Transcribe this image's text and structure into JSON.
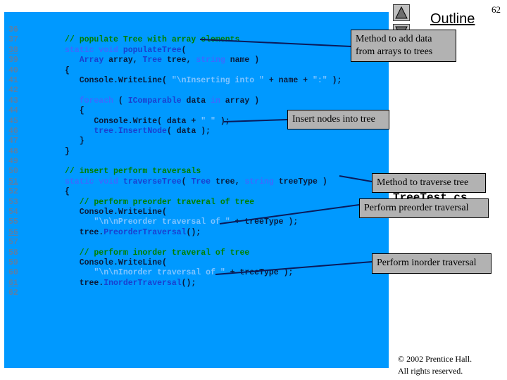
{
  "slide": {
    "page_number": "62",
    "outline_label": "Outline",
    "filename": "TreeTest.cs",
    "copyright_line1": "© 2002 Prentice Hall.",
    "copyright_line2": "All rights reserved.",
    "colors": {
      "code_background": "#0099ff",
      "callout_background": "#b2b2b2",
      "comment": "#008000",
      "keyword": "#3b6bff",
      "line_number": "#5b7fa6"
    }
  },
  "navigation": {
    "up_icon": "triangle-up-icon",
    "down_icon": "triangle-down-icon"
  },
  "code": {
    "lines": [
      {
        "num": "36",
        "underline": false,
        "tokens": []
      },
      {
        "num": "37",
        "underline": false,
        "tokens": [
          {
            "c": "t-comment",
            "t": "// populate Tree with array elements"
          }
        ]
      },
      {
        "num": "38",
        "underline": true,
        "tokens": [
          {
            "c": "t-kw",
            "t": "static void "
          },
          {
            "c": "t-type",
            "t": "populateTree"
          },
          {
            "c": "t-plain",
            "t": "("
          }
        ]
      },
      {
        "num": "39",
        "underline": false,
        "tokens": [
          {
            "c": "t-plain",
            "t": "   "
          },
          {
            "c": "t-type",
            "t": "Array"
          },
          {
            "c": "t-plain",
            "t": " array, "
          },
          {
            "c": "t-type",
            "t": "Tree"
          },
          {
            "c": "t-plain",
            "t": " tree, "
          },
          {
            "c": "t-kw",
            "t": "string"
          },
          {
            "c": "t-plain",
            "t": " name )"
          }
        ]
      },
      {
        "num": "40",
        "underline": false,
        "tokens": [
          {
            "c": "t-plain",
            "t": "{"
          }
        ]
      },
      {
        "num": "41",
        "underline": false,
        "tokens": [
          {
            "c": "t-plain",
            "t": "   Console.WriteLine( "
          },
          {
            "c": "t-str",
            "t": "\"\\nInserting into \""
          },
          {
            "c": "t-plain",
            "t": " + name + "
          },
          {
            "c": "t-str",
            "t": "\":\""
          },
          {
            "c": "t-plain",
            "t": " );"
          }
        ]
      },
      {
        "num": "42",
        "underline": false,
        "tokens": []
      },
      {
        "num": "43",
        "underline": false,
        "tokens": [
          {
            "c": "t-kw",
            "t": "   foreach"
          },
          {
            "c": "t-plain",
            "t": " ( "
          },
          {
            "c": "t-type",
            "t": "IComparable"
          },
          {
            "c": "t-plain",
            "t": " data "
          },
          {
            "c": "t-kw",
            "t": "in"
          },
          {
            "c": "t-plain",
            "t": " array )"
          }
        ]
      },
      {
        "num": "44",
        "underline": false,
        "tokens": [
          {
            "c": "t-plain",
            "t": "   {"
          }
        ]
      },
      {
        "num": "45",
        "underline": false,
        "tokens": [
          {
            "c": "t-plain",
            "t": "      Console.Write( data + "
          },
          {
            "c": "t-str",
            "t": "\" \""
          },
          {
            "c": "t-plain",
            "t": " );"
          }
        ]
      },
      {
        "num": "46",
        "underline": true,
        "tokens": [
          {
            "c": "t-member",
            "t": "      tree.InsertNode"
          },
          {
            "c": "t-plain",
            "t": "( data );"
          }
        ]
      },
      {
        "num": "47",
        "underline": false,
        "tokens": [
          {
            "c": "t-plain",
            "t": "   }"
          }
        ]
      },
      {
        "num": "48",
        "underline": false,
        "tokens": [
          {
            "c": "t-plain",
            "t": "}"
          }
        ]
      },
      {
        "num": "49",
        "underline": false,
        "tokens": []
      },
      {
        "num": "50",
        "underline": false,
        "tokens": [
          {
            "c": "t-comment",
            "t": "// insert perform traversals"
          }
        ]
      },
      {
        "num": "51",
        "underline": true,
        "tokens": [
          {
            "c": "t-kw",
            "t": "static void "
          },
          {
            "c": "t-type",
            "t": "traverseTree"
          },
          {
            "c": "t-plain",
            "t": "( "
          },
          {
            "c": "t-type",
            "t": "Tree"
          },
          {
            "c": "t-plain",
            "t": " tree, "
          },
          {
            "c": "t-kw",
            "t": "string"
          },
          {
            "c": "t-plain",
            "t": " treeType )"
          }
        ]
      },
      {
        "num": "52",
        "underline": false,
        "tokens": [
          {
            "c": "t-plain",
            "t": "{"
          }
        ]
      },
      {
        "num": "53",
        "underline": false,
        "tokens": [
          {
            "c": "t-comment",
            "t": "   // perform preorder traveral of tree"
          }
        ]
      },
      {
        "num": "54",
        "underline": false,
        "tokens": [
          {
            "c": "t-plain",
            "t": "   Console.WriteLine("
          }
        ]
      },
      {
        "num": "55",
        "underline": false,
        "tokens": [
          {
            "c": "t-str",
            "t": "      \"\\n\\nPreorder traversal of \""
          },
          {
            "c": "t-plain",
            "t": " + treeType );"
          }
        ]
      },
      {
        "num": "56",
        "underline": true,
        "tokens": [
          {
            "c": "t-plain",
            "t": "   tree."
          },
          {
            "c": "t-member",
            "t": "PreorderTraversal"
          },
          {
            "c": "t-plain",
            "t": "();"
          }
        ]
      },
      {
        "num": "57",
        "underline": false,
        "tokens": []
      },
      {
        "num": "58",
        "underline": false,
        "tokens": [
          {
            "c": "t-comment",
            "t": "   // perform inorder traveral of tree"
          }
        ]
      },
      {
        "num": "59",
        "underline": false,
        "tokens": [
          {
            "c": "t-plain",
            "t": "   Console.WriteLine("
          }
        ]
      },
      {
        "num": "60",
        "underline": false,
        "tokens": [
          {
            "c": "t-str",
            "t": "      \"\\n\\nInorder traversal of \""
          },
          {
            "c": "t-plain",
            "t": " + treeType );"
          }
        ]
      },
      {
        "num": "61",
        "underline": true,
        "tokens": [
          {
            "c": "t-plain",
            "t": "   tree."
          },
          {
            "c": "t-member",
            "t": "InorderTraversal"
          },
          {
            "c": "t-plain",
            "t": "();"
          }
        ]
      },
      {
        "num": "62",
        "underline": false,
        "tokens": []
      }
    ]
  },
  "callouts": {
    "add_data": "Method to add data from arrays to trees",
    "insert_nodes": "Insert nodes into tree",
    "traverse": "Method to traverse tree",
    "preorder": "Perform preorder traversal",
    "inorder": "Perform inorder traversal"
  }
}
